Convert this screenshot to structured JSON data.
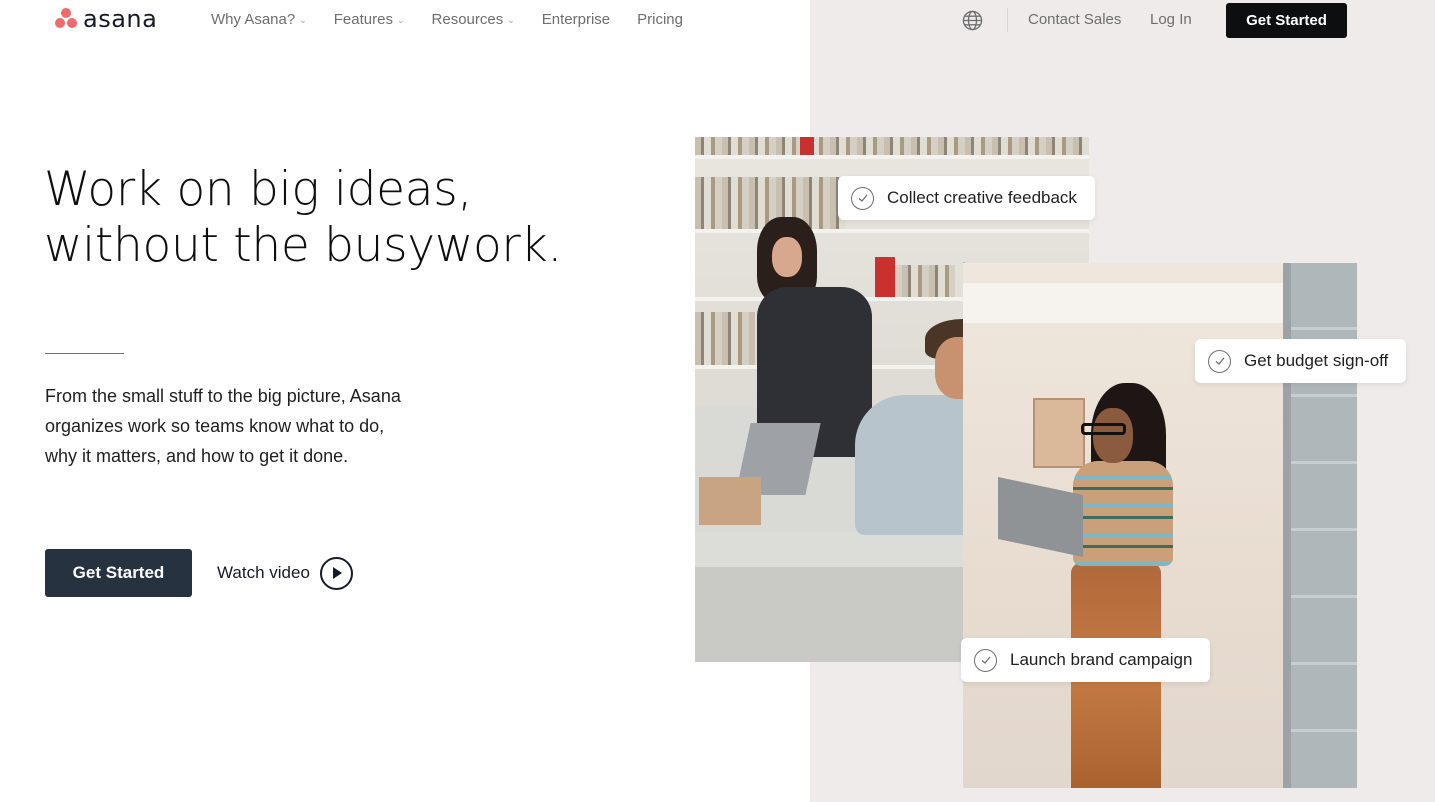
{
  "brand": {
    "name": "asana",
    "accent_color": "#f06a6a"
  },
  "nav": {
    "links": [
      {
        "label": "Why Asana?",
        "has_dropdown": true
      },
      {
        "label": "Features",
        "has_dropdown": true
      },
      {
        "label": "Resources",
        "has_dropdown": true
      },
      {
        "label": "Enterprise",
        "has_dropdown": false
      },
      {
        "label": "Pricing",
        "has_dropdown": false
      }
    ],
    "language_icon": "globe-icon",
    "contact_sales": "Contact Sales",
    "log_in": "Log In",
    "cta": "Get Started"
  },
  "hero": {
    "headline_lines": [
      "Work on big ideas,",
      "without the busywork."
    ],
    "subcopy_lines": [
      "From the small stuff to the big picture, Asana",
      "organizes work so teams know what to do,",
      "why it matters, and how to get it done."
    ],
    "primary_cta": "Get Started",
    "secondary_cta": "Watch video",
    "secondary_cta_icon": "play-circle-icon"
  },
  "visual": {
    "photos": [
      {
        "description": "Two coworkers at a desk with laptop in a studio with bookshelves"
      },
      {
        "description": "Woman in glasses holding a laptop, leaning against a column"
      }
    ],
    "tasks": [
      {
        "label": "Collect creative feedback",
        "icon": "check-circle-icon"
      },
      {
        "label": "Get budget sign-off",
        "icon": "check-circle-icon"
      },
      {
        "label": "Launch brand campaign",
        "icon": "check-circle-icon"
      }
    ]
  },
  "colors": {
    "nav_cta_bg": "#0d0e10",
    "hero_cta_bg": "#273240",
    "panel_bg": "#efebea",
    "nav_text": "#6d6e6f"
  }
}
